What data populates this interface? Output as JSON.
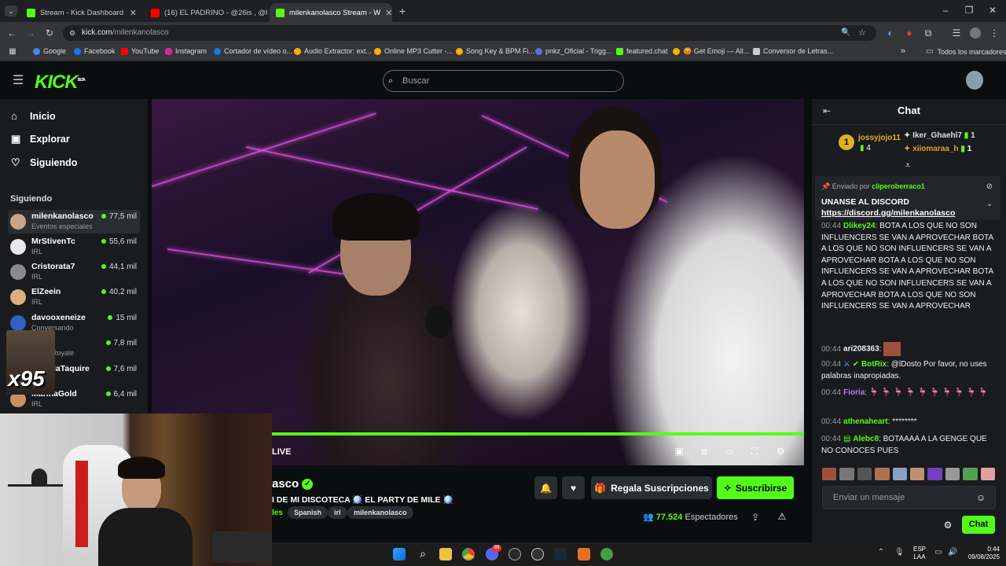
{
  "browser": {
    "tabs": [
      {
        "title": "Stream - Kick Dashboard",
        "active": false,
        "fav_color": "#53fc18"
      },
      {
        "title": "(16) EL PADRINO - @26is , @he",
        "active": false,
        "fav_color": "#ff0000"
      },
      {
        "title": "milenkanolasco Stream - W",
        "active": true,
        "fav_color": "#53fc18"
      }
    ],
    "new_tab": "+",
    "url_domain": "kick.com",
    "url_path": "/milenkanolasco",
    "bookmarks": [
      "Google",
      "Facebook",
      "YouTube",
      "Instagram",
      "Cortador de vídeo o...",
      "Audio Extractor: ext...",
      "Online MP3 Cutter -...",
      "Song Key & BPM Fi...",
      "pnkz_Oficial - Trigg...",
      "featured.chat",
      "😡 Get Emoji — All...",
      "Conversor de Letras..."
    ],
    "bookmarks_overflow": "»",
    "all_bookmarks": "Todos los marcadores"
  },
  "kick": {
    "logo": "KICK",
    "logo_beta": "BETA",
    "search_placeholder": "Buscar"
  },
  "sidebar": {
    "nav": [
      {
        "label": "Inicio",
        "icon": "home-icon"
      },
      {
        "label": "Explorar",
        "icon": "explore-icon"
      },
      {
        "label": "Siguiendo",
        "icon": "heart-icon"
      }
    ],
    "following_title": "Siguiendo",
    "following": [
      {
        "name": "milenkanolasco",
        "category": "Eventos especiales",
        "viewers": "77,5 mil",
        "color": "#c9a58a"
      },
      {
        "name": "MrStivenTc",
        "category": "IRL",
        "viewers": "55,6 mil",
        "color": "#e8e8e8"
      },
      {
        "name": "Cristorata7",
        "category": "IRL",
        "viewers": "44,1 mil",
        "color": "#8a8a8a"
      },
      {
        "name": "ElZeein",
        "category": "IRL",
        "viewers": "40,2 mil",
        "color": "#d8b080"
      },
      {
        "name": "davooxeneize",
        "category": "Conversando",
        "viewers": "15 mil",
        "color": "#3060c0"
      },
      {
        "name": "",
        "category": "Royale",
        "viewers": "7,8 mil",
        "color": "#555"
      },
      {
        "name": "laTaquire",
        "category": "",
        "viewers": "7,6 mil",
        "color": "#555"
      },
      {
        "name": "MarinaGold",
        "category": "IRL",
        "viewers": "6,4 mil",
        "color": "#c89060"
      }
    ],
    "overlay_text": "x95"
  },
  "player": {
    "live_label": "LIVE"
  },
  "stream": {
    "channel_partial": "asco",
    "title_partial": "I DE MI DISCOTECA 🪩 EL PARTY DE MILE 🪩",
    "category_partial": "les",
    "tags": [
      "Spanish",
      "irl",
      "milenkanolasco"
    ],
    "gift_label": "Regala Suscripciones",
    "subscribe_label": "Suscribirse",
    "viewers_count": "77.524",
    "viewers_label": "Espectadores"
  },
  "chat": {
    "title": "Chat",
    "leaders": [
      {
        "name": "jossyjojo11",
        "count": "4"
      },
      {
        "name": "Iker_Ghaehl7",
        "count": "1"
      },
      {
        "name": "xiiomaraa_h",
        "count": "1"
      }
    ],
    "pinned_by_label": "Enviado por",
    "pinned_by_user": "cliperoberraco1",
    "pinned_text": "UNANSE AL DISCORD",
    "pinned_link": "https://discord.gg/milenkanolasco",
    "messages": [
      {
        "time": "00:44",
        "user": "Dlikey24",
        "color": "#53fc18",
        "text": ": BOTA A LOS QUE NO SON INFLUENCERS SE VAN A APROVECHAR BOTA A LOS QUE NO SON INFLUENCERS SE VAN A APROVECHAR BOTA A LOS QUE NO SON INFLUENCERS SE VAN A APROVECHAR BOTA A LOS QUE NO SON INFLUENCERS SE VAN A APROVECHAR BOTA A LOS QUE NO SON INFLUENCERS SE VAN A APROVECHAR"
      },
      {
        "time": "00:44",
        "user": "ari208363",
        "color": "#e8e8e8",
        "text": ""
      },
      {
        "time": "00:44",
        "user": "BotRix",
        "color": "#53fc18",
        "text": "@lDosto Por favor, no uses palabras inapropiadas."
      },
      {
        "time": "00:44",
        "user": "Fioria",
        "color": "#c070ff",
        "text": ""
      },
      {
        "time": "00:44",
        "user": "athenaheart",
        "color": "#53fc18",
        "text": "********"
      },
      {
        "time": "00:44",
        "user": "Alebc8",
        "color": "#53fc18",
        "text": "BOTAAAA A LA GENGE QUE NO CONOCES PUES"
      }
    ],
    "input_placeholder": "Enviar un mensaje",
    "send_label": "Chat"
  },
  "taskbar": {
    "lang": "ESP",
    "lang2": "LAA",
    "time": "0:44",
    "date": "09/08/2025",
    "notif_badge": "99"
  }
}
